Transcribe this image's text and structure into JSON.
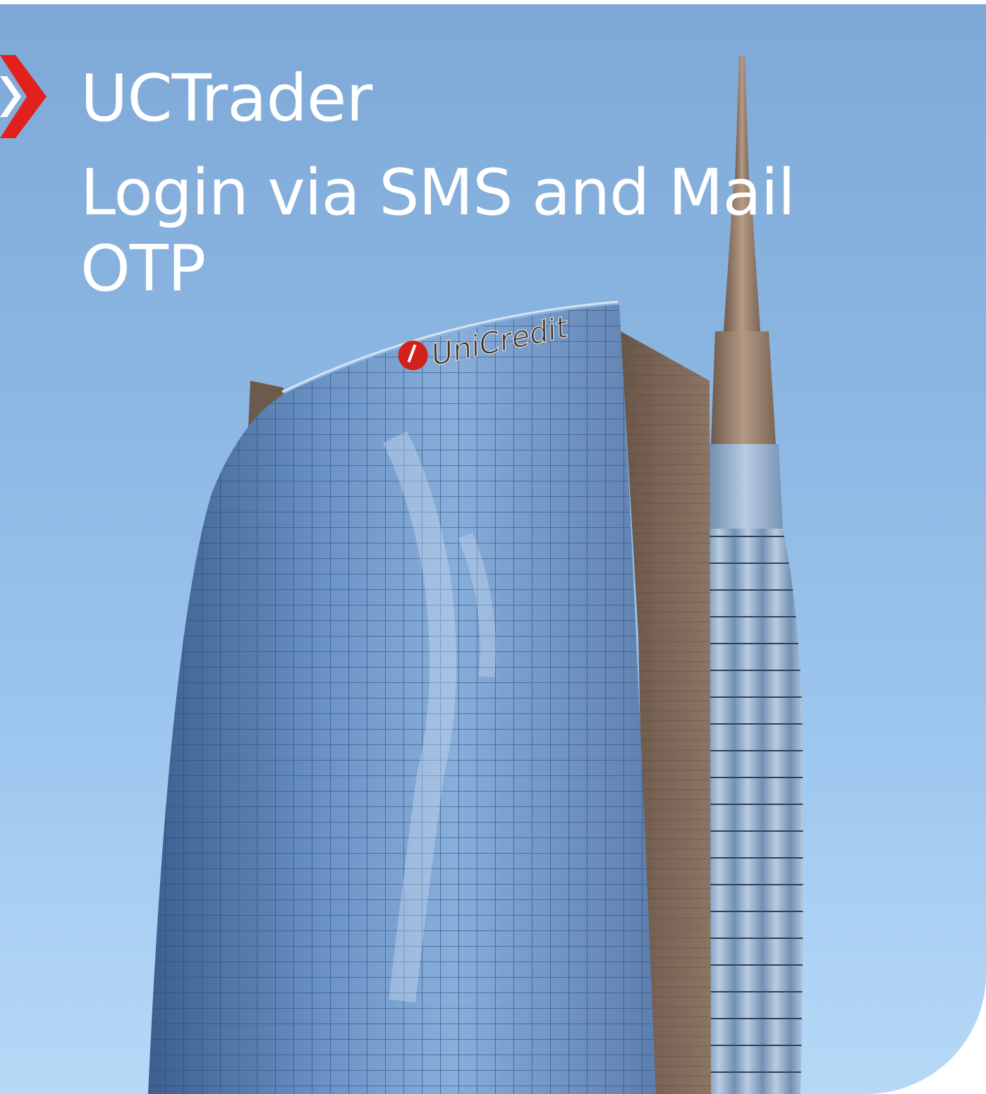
{
  "header": {
    "app_name": "UCTrader",
    "subtitle": "Login via SMS and Mail OTP"
  },
  "brand": {
    "logo_text": "UniCredit",
    "accent_color": "#e2211c"
  },
  "colors": {
    "sky_top": "#7ea8d6",
    "sky_bottom": "#b7d9f7",
    "title_text": "#ffffff"
  },
  "icons": {
    "brand_mark": "chevron-icon",
    "logo_mark": "unicredit-logo-icon"
  }
}
